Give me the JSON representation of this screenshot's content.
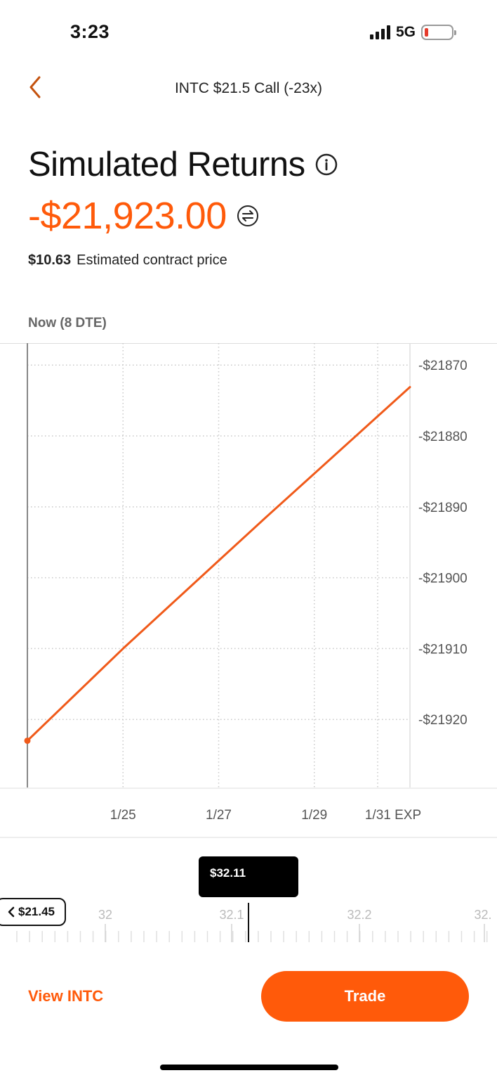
{
  "status_bar": {
    "time": "3:23",
    "network": "5G"
  },
  "nav": {
    "title": "INTC $21.5 Call (-23x)"
  },
  "header": {
    "title": "Simulated Returns",
    "value": "-$21,923.00",
    "contract_price": "$10.63",
    "contract_price_label": "Estimated contract price",
    "now_label": "Now (8 DTE)"
  },
  "chart_data": {
    "type": "line",
    "x_ticks": [
      "1/25",
      "1/27",
      "1/29",
      "1/31 EXP"
    ],
    "y_ticks": [
      "-$21870",
      "-$21880",
      "-$21890",
      "-$21900",
      "-$21910",
      "-$21920"
    ],
    "y_tick_values": [
      -21870,
      -21880,
      -21890,
      -21900,
      -21910,
      -21920
    ],
    "ylim": [
      -21929.6,
      -21866.9
    ],
    "x": [
      "1/23",
      "1/24",
      "1/25",
      "1/26",
      "1/27",
      "1/28",
      "1/29",
      "1/30",
      "1/31"
    ],
    "series": [
      {
        "values": [
          -21923.0,
          -21916.5,
          -21910.0,
          -21903.8,
          -21897.6,
          -21891.4,
          -21885.3,
          -21879.2,
          -21873.1
        ]
      }
    ],
    "grid": true,
    "color": "#f05a1a"
  },
  "slider": {
    "selected_price": "$32.11",
    "strike_label": "$21.45",
    "ticks": [
      "32",
      "32.1",
      "32.2",
      "32."
    ]
  },
  "actions": {
    "view_label": "View INTC",
    "trade_label": "Trade"
  },
  "colors": {
    "accent": "#ff5a0a",
    "line": "#f05a1a"
  }
}
